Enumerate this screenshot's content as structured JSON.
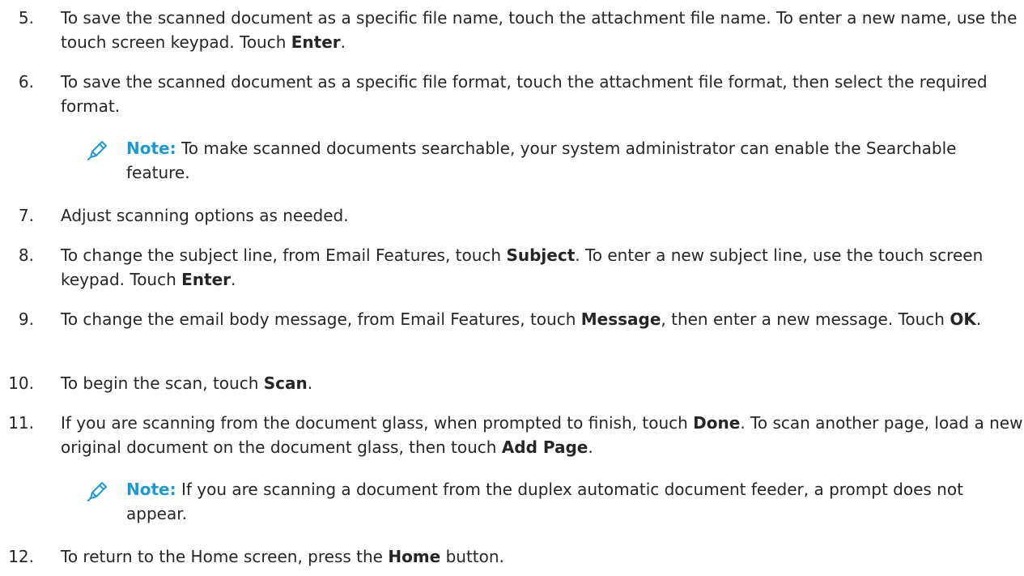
{
  "steps": [
    {
      "num": "5.",
      "parts": [
        "To save the scanned document as a specific file name, touch the attachment file name. To enter a new name, use the touch screen keypad. Touch ",
        "Enter",
        "."
      ]
    },
    {
      "num": "6.",
      "parts": [
        "To save the scanned document as a specific file format, touch the attachment file format, then select the required format."
      ]
    },
    {
      "num": "7.",
      "parts": [
        "Adjust scanning options as needed."
      ]
    },
    {
      "num": "8.",
      "parts": [
        "To change the subject line, from Email Features, touch ",
        "Subject",
        ". To enter a new subject line, use the touch screen keypad. Touch ",
        "Enter",
        "."
      ]
    },
    {
      "num": "9.",
      "parts": [
        "To change the email body message, from Email Features, touch ",
        "Message",
        ", then enter a new message. Touch ",
        "OK",
        "."
      ]
    },
    {
      "num": "10.",
      "parts": [
        "To begin the scan, touch ",
        "Scan",
        "."
      ]
    },
    {
      "num": "11.",
      "parts": [
        "If you are scanning from the document glass, when prompted to finish, touch ",
        "Done",
        ". To scan another page, load a new original document on the document glass, then touch ",
        "Add Page",
        "."
      ]
    },
    {
      "num": "12.",
      "parts": [
        "To return to the Home screen, press the ",
        "Home",
        " button."
      ]
    }
  ],
  "notes": [
    {
      "label": "Note:",
      "text": " To make scanned documents searchable, your system administrator can enable the Searchable feature."
    },
    {
      "label": "Note:",
      "text": " If you are scanning a document from the duplex automatic document feeder, a prompt does not appear."
    }
  ],
  "colors": {
    "text": "#262626",
    "note_label": "#1c9ad6",
    "icon": "#1c9ad6"
  },
  "icons": {
    "note": "pencil-icon"
  }
}
